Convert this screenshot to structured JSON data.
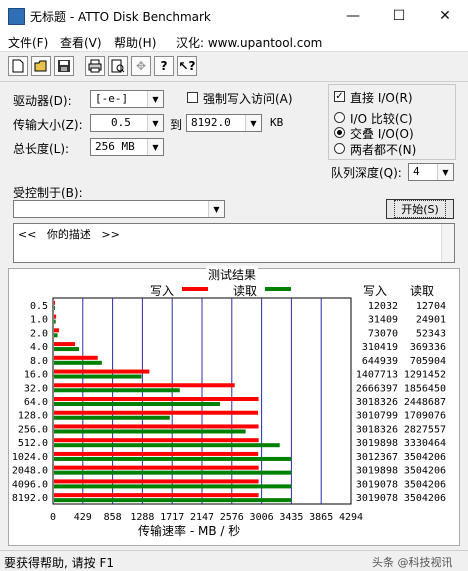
{
  "window": {
    "title": "无标题 - ATTO Disk Benchmark",
    "minimize": "—",
    "maximize": "☐",
    "close": "✕"
  },
  "menu": {
    "file": "文件(F)",
    "view": "查看(V)",
    "help": "帮助(H)",
    "localized": "汉化: www.upantool.com"
  },
  "toolbar": {
    "icons": [
      "new-icon",
      "open-icon",
      "save-icon",
      "print-icon",
      "print-preview-icon",
      "move-icon",
      "help-icon",
      "context-help-icon"
    ]
  },
  "settings": {
    "drive_label": "驱动器(D):",
    "drive_value": "[-e-]",
    "force_write_label": "强制写入访问(A)",
    "transfer_label": "传输大小(Z):",
    "transfer_from": "0.5",
    "to_label": "到",
    "transfer_to": "8192.0",
    "unit": "KB",
    "total_length_label": "总长度(L):",
    "total_length_value": "256 MB",
    "direct_io_label": "直接 I/O(R)",
    "io_compare_label": "I/O 比较(C)",
    "overlapped_io_label": "交叠 I/O(O)",
    "neither_label": "两者都不(N)",
    "queue_depth_label": "队列深度(Q):",
    "queue_depth_value": "4",
    "controlled_by_label": "受控制于(B):",
    "controlled_by_value": "",
    "start_label": "开始(S)",
    "description": "<<   你的描述   >>"
  },
  "results": {
    "title": "测试结果",
    "legend_write": "写入",
    "legend_read": "读取",
    "col_write": "写入",
    "col_read": "读取",
    "write_color": "#ff0000",
    "read_color": "#008000",
    "rows": [
      {
        "size": "0.5",
        "write": "12032",
        "read": "12704"
      },
      {
        "size": "1.0",
        "write": "31409",
        "read": "24901"
      },
      {
        "size": "2.0",
        "write": "73070",
        "read": "52343"
      },
      {
        "size": "4.0",
        "write": "310419",
        "read": "369336"
      },
      {
        "size": "8.0",
        "write": "644939",
        "read": "705904"
      },
      {
        "size": "16.0",
        "write": "1407713",
        "read": "1291452"
      },
      {
        "size": "32.0",
        "write": "2666397",
        "read": "1856450"
      },
      {
        "size": "64.0",
        "write": "3018326",
        "read": "2448687"
      },
      {
        "size": "128.0",
        "write": "3010799",
        "read": "1709076"
      },
      {
        "size": "256.0",
        "write": "3018326",
        "read": "2827557"
      },
      {
        "size": "512.0",
        "write": "3019898",
        "read": "3330464"
      },
      {
        "size": "1024.0",
        "write": "3012367",
        "read": "3504206"
      },
      {
        "size": "2048.0",
        "write": "3019898",
        "read": "3504206"
      },
      {
        "size": "4096.0",
        "write": "3019078",
        "read": "3504206"
      },
      {
        "size": "8192.0",
        "write": "3019078",
        "read": "3504206"
      }
    ],
    "axis_ticks": [
      "0",
      "429",
      "858",
      "1288",
      "1717",
      "2147",
      "2576",
      "3006",
      "3435",
      "3865",
      "4294"
    ],
    "axis_max": 4294,
    "xlabel": "传输速率 - MB / 秒"
  },
  "status": {
    "text": "要获得帮助, 请按 F1",
    "watermark": "头条 @科技视讯"
  }
}
